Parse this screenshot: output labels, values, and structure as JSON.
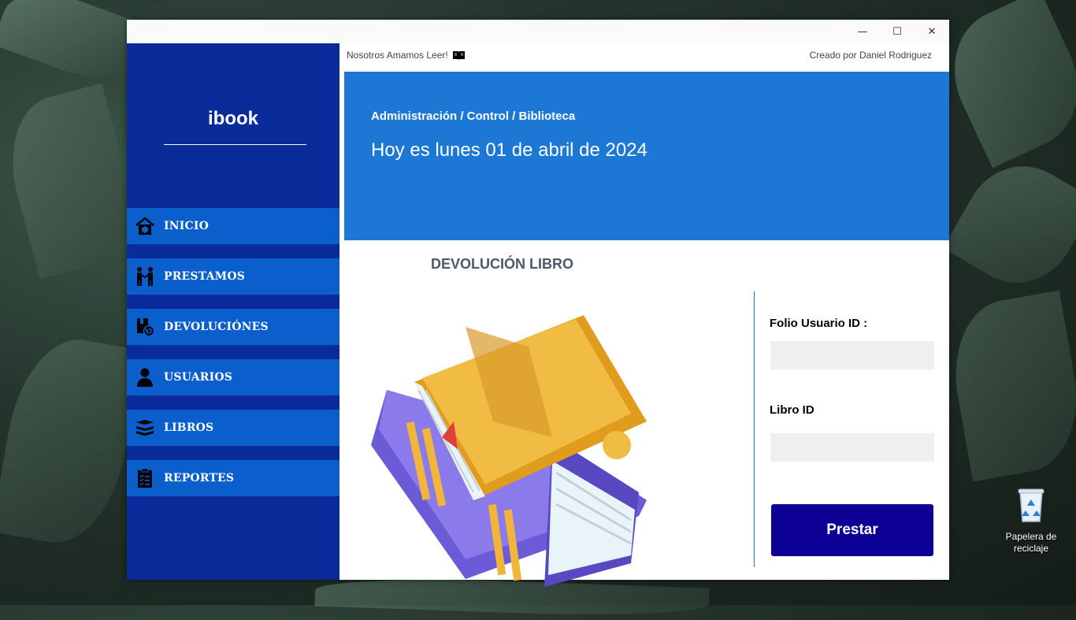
{
  "desktop": {
    "recycle_bin_label": "Papelera de reciclaje"
  },
  "window": {
    "controls": {
      "minimize": "—",
      "maximize": "☐",
      "close": "✕"
    }
  },
  "sidebar": {
    "brand": "ibook",
    "items": [
      {
        "label": "INICIO",
        "icon": "home-icon"
      },
      {
        "label": "PRESTAMOS",
        "icon": "handshake-icon"
      },
      {
        "label": "DEVOLUCIÓNES",
        "icon": "return-book-icon"
      },
      {
        "label": "USUARIOS",
        "icon": "user-icon"
      },
      {
        "label": "LIBROS",
        "icon": "books-icon"
      },
      {
        "label": "REPORTES",
        "icon": "clipboard-icon"
      }
    ]
  },
  "header": {
    "tagline": "Nosotros Amamos Leer!",
    "credit": "Creado por Daniel Rodriguez"
  },
  "banner": {
    "breadcrumb": "Administración / Control / Biblioteca",
    "date": "Hoy es lunes 01 de abril de 2024"
  },
  "form": {
    "title": "DEVOLUCIÓN LIBRO",
    "folio_label": "Folio Usuario ID :",
    "folio_value": "",
    "libro_label": "Libro ID",
    "libro_value": "",
    "submit_label": "Prestar"
  },
  "colors": {
    "sidebar": "#0a2b99",
    "nav_item": "#0a5fcc",
    "banner": "#1c78d4",
    "button": "#0d0094"
  }
}
